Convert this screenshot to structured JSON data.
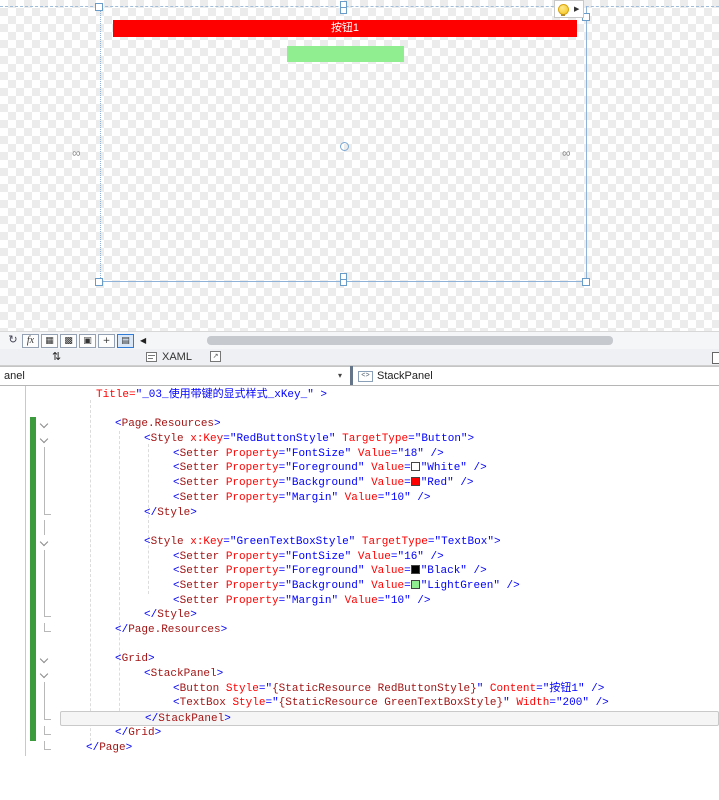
{
  "design": {
    "button_label": "按钮1",
    "button_color": "#ff0000",
    "textbox_color": "#90ee90",
    "bulb_arrow": "▶",
    "chain_glyph": "∞"
  },
  "toolbar": {
    "buttons": [
      {
        "name": "refresh-icon",
        "glyph": "↻",
        "boxed": false,
        "active": false
      },
      {
        "name": "effects-fx-icon",
        "glyph": "fx",
        "boxed": true,
        "active": false
      },
      {
        "name": "grid-rails-icon",
        "glyph": "▦",
        "boxed": true,
        "active": false
      },
      {
        "name": "grid-handles-icon",
        "glyph": "▩",
        "boxed": true,
        "active": false
      },
      {
        "name": "snap-grid-icon",
        "glyph": "▣",
        "boxed": true,
        "active": false
      },
      {
        "name": "snaplines-icon",
        "glyph": "+",
        "boxed": true,
        "active": false
      },
      {
        "name": "document-outline-icon",
        "glyph": "▤",
        "boxed": true,
        "active": true
      }
    ],
    "collapse_glyph": "◀"
  },
  "tabs": {
    "sort_glyph": "⇅",
    "xaml_label": "XAML"
  },
  "breadcrumb": {
    "left_value": "anel",
    "left_arrow": "▾",
    "right_icon_glyph": "<>",
    "right_value": "StackPanel"
  },
  "editor": {
    "change_bar_color": "#3c9b3c",
    "colors": {
      "delim": "#0000ff",
      "elem": "#a31515",
      "attr": "#ff0000",
      "value": "#0000ff",
      "plain": "#000000"
    },
    "lines": [
      {
        "ind": 36,
        "seg": [
          [
            "a",
            "Title="
          ],
          [
            "v",
            "\"_03_使用带键的显式样式_xKey_\""
          ],
          [
            "d",
            " >"
          ]
        ]
      },
      {
        "ind": 0,
        "seg": []
      },
      {
        "ind": 55,
        "fold": "o",
        "chg": true,
        "seg": [
          [
            "d",
            "<"
          ],
          [
            "e",
            "Page.Resources"
          ],
          [
            "d",
            ">"
          ]
        ]
      },
      {
        "ind": 84,
        "fold": "o",
        "chg": true,
        "seg": [
          [
            "d",
            "<"
          ],
          [
            "e",
            "Style"
          ],
          [
            "p",
            " "
          ],
          [
            "a",
            "x:Key"
          ],
          [
            "d",
            "="
          ],
          [
            "v",
            "\"RedButtonStyle\""
          ],
          [
            "p",
            " "
          ],
          [
            "a",
            "TargetType"
          ],
          [
            "d",
            "="
          ],
          [
            "v",
            "\"Button\""
          ],
          [
            "d",
            ">"
          ]
        ]
      },
      {
        "ind": 113,
        "fold": "i",
        "chg": true,
        "seg": [
          [
            "d",
            "<"
          ],
          [
            "e",
            "Setter"
          ],
          [
            "p",
            " "
          ],
          [
            "a",
            "Property"
          ],
          [
            "d",
            "="
          ],
          [
            "v",
            "\"FontSize\""
          ],
          [
            "p",
            " "
          ],
          [
            "a",
            "Value"
          ],
          [
            "d",
            "="
          ],
          [
            "v",
            "\"18\""
          ],
          [
            "d",
            " />"
          ]
        ]
      },
      {
        "ind": 113,
        "fold": "i",
        "chg": true,
        "seg": [
          [
            "d",
            "<"
          ],
          [
            "e",
            "Setter"
          ],
          [
            "p",
            " "
          ],
          [
            "a",
            "Property"
          ],
          [
            "d",
            "="
          ],
          [
            "v",
            "\"Foreground\""
          ],
          [
            "p",
            " "
          ],
          [
            "a",
            "Value"
          ],
          [
            "d",
            "="
          ],
          [
            "sw",
            "#ffffff"
          ],
          [
            "v",
            "\"White\""
          ],
          [
            "d",
            " />"
          ]
        ]
      },
      {
        "ind": 113,
        "fold": "i",
        "chg": true,
        "seg": [
          [
            "d",
            "<"
          ],
          [
            "e",
            "Setter"
          ],
          [
            "p",
            " "
          ],
          [
            "a",
            "Property"
          ],
          [
            "d",
            "="
          ],
          [
            "v",
            "\"Background\""
          ],
          [
            "p",
            " "
          ],
          [
            "a",
            "Value"
          ],
          [
            "d",
            "="
          ],
          [
            "sw",
            "#ff0000"
          ],
          [
            "v",
            "\"Red\""
          ],
          [
            "d",
            " />"
          ]
        ]
      },
      {
        "ind": 113,
        "fold": "i",
        "chg": true,
        "seg": [
          [
            "d",
            "<"
          ],
          [
            "e",
            "Setter"
          ],
          [
            "p",
            " "
          ],
          [
            "a",
            "Property"
          ],
          [
            "d",
            "="
          ],
          [
            "v",
            "\"Margin\""
          ],
          [
            "p",
            " "
          ],
          [
            "a",
            "Value"
          ],
          [
            "d",
            "="
          ],
          [
            "v",
            "\"10\""
          ],
          [
            "d",
            " />"
          ]
        ]
      },
      {
        "ind": 84,
        "fold": "c",
        "chg": true,
        "seg": [
          [
            "d",
            "</"
          ],
          [
            "e",
            "Style"
          ],
          [
            "d",
            ">"
          ]
        ]
      },
      {
        "ind": 0,
        "fold": "i",
        "chg": true,
        "seg": []
      },
      {
        "ind": 84,
        "fold": "o",
        "chg": true,
        "seg": [
          [
            "d",
            "<"
          ],
          [
            "e",
            "Style"
          ],
          [
            "p",
            " "
          ],
          [
            "a",
            "x:Key"
          ],
          [
            "d",
            "="
          ],
          [
            "v",
            "\"GreenTextBoxStyle\""
          ],
          [
            "p",
            " "
          ],
          [
            "a",
            "TargetType"
          ],
          [
            "d",
            "="
          ],
          [
            "v",
            "\"TextBox\""
          ],
          [
            "d",
            ">"
          ]
        ]
      },
      {
        "ind": 113,
        "fold": "i",
        "chg": true,
        "seg": [
          [
            "d",
            "<"
          ],
          [
            "e",
            "Setter"
          ],
          [
            "p",
            " "
          ],
          [
            "a",
            "Property"
          ],
          [
            "d",
            "="
          ],
          [
            "v",
            "\"FontSize\""
          ],
          [
            "p",
            " "
          ],
          [
            "a",
            "Value"
          ],
          [
            "d",
            "="
          ],
          [
            "v",
            "\"16\""
          ],
          [
            "d",
            " />"
          ]
        ]
      },
      {
        "ind": 113,
        "fold": "i",
        "chg": true,
        "seg": [
          [
            "d",
            "<"
          ],
          [
            "e",
            "Setter"
          ],
          [
            "p",
            " "
          ],
          [
            "a",
            "Property"
          ],
          [
            "d",
            "="
          ],
          [
            "v",
            "\"Foreground\""
          ],
          [
            "p",
            " "
          ],
          [
            "a",
            "Value"
          ],
          [
            "d",
            "="
          ],
          [
            "sw",
            "#000000"
          ],
          [
            "v",
            "\"Black\""
          ],
          [
            "d",
            " />"
          ]
        ]
      },
      {
        "ind": 113,
        "fold": "i",
        "chg": true,
        "seg": [
          [
            "d",
            "<"
          ],
          [
            "e",
            "Setter"
          ],
          [
            "p",
            " "
          ],
          [
            "a",
            "Property"
          ],
          [
            "d",
            "="
          ],
          [
            "v",
            "\"Background\""
          ],
          [
            "p",
            " "
          ],
          [
            "a",
            "Value"
          ],
          [
            "d",
            "="
          ],
          [
            "sw",
            "#90ee90"
          ],
          [
            "v",
            "\"LightGreen\""
          ],
          [
            "d",
            " />"
          ]
        ]
      },
      {
        "ind": 113,
        "fold": "i",
        "chg": true,
        "seg": [
          [
            "d",
            "<"
          ],
          [
            "e",
            "Setter"
          ],
          [
            "p",
            " "
          ],
          [
            "a",
            "Property"
          ],
          [
            "d",
            "="
          ],
          [
            "v",
            "\"Margin\""
          ],
          [
            "p",
            " "
          ],
          [
            "a",
            "Value"
          ],
          [
            "d",
            "="
          ],
          [
            "v",
            "\"10\""
          ],
          [
            "d",
            " />"
          ]
        ]
      },
      {
        "ind": 84,
        "fold": "c",
        "chg": true,
        "seg": [
          [
            "d",
            "</"
          ],
          [
            "e",
            "Style"
          ],
          [
            "d",
            ">"
          ]
        ]
      },
      {
        "ind": 55,
        "fold": "c",
        "chg": true,
        "seg": [
          [
            "d",
            "</"
          ],
          [
            "e",
            "Page.Resources"
          ],
          [
            "d",
            ">"
          ]
        ]
      },
      {
        "ind": 0,
        "chg": true,
        "seg": []
      },
      {
        "ind": 55,
        "fold": "o",
        "chg": true,
        "seg": [
          [
            "d",
            "<"
          ],
          [
            "e",
            "Grid"
          ],
          [
            "d",
            ">"
          ]
        ]
      },
      {
        "ind": 84,
        "fold": "o",
        "chg": true,
        "seg": [
          [
            "d",
            "<"
          ],
          [
            "e",
            "StackPanel"
          ],
          [
            "d",
            ">"
          ]
        ]
      },
      {
        "ind": 113,
        "fold": "i",
        "chg": true,
        "seg": [
          [
            "d",
            "<"
          ],
          [
            "e",
            "Button"
          ],
          [
            "p",
            " "
          ],
          [
            "a",
            "Style"
          ],
          [
            "d",
            "="
          ],
          [
            "v",
            "\""
          ],
          [
            "e",
            "{StaticResource RedButtonStyle}"
          ],
          [
            "v",
            "\""
          ],
          [
            "p",
            " "
          ],
          [
            "a",
            "Content"
          ],
          [
            "d",
            "="
          ],
          [
            "v",
            "\"按钮1\""
          ],
          [
            "d",
            " />"
          ]
        ]
      },
      {
        "ind": 113,
        "fold": "i",
        "chg": true,
        "seg": [
          [
            "d",
            "<"
          ],
          [
            "e",
            "TextBox"
          ],
          [
            "p",
            " "
          ],
          [
            "a",
            "Style"
          ],
          [
            "d",
            "="
          ],
          [
            "v",
            "\""
          ],
          [
            "e",
            "{StaticResource GreenTextBoxStyle}"
          ],
          [
            "v",
            "\""
          ],
          [
            "p",
            " "
          ],
          [
            "a",
            "Width"
          ],
          [
            "d",
            "="
          ],
          [
            "v",
            "\"200\""
          ],
          [
            "d",
            " />"
          ]
        ]
      },
      {
        "ind": 84,
        "fold": "c",
        "chg": true,
        "cur": true,
        "seg": [
          [
            "d",
            "</"
          ],
          [
            "e",
            "StackPanel"
          ],
          [
            "d",
            ">"
          ]
        ]
      },
      {
        "ind": 55,
        "fold": "c",
        "chg": true,
        "seg": [
          [
            "d",
            "</"
          ],
          [
            "e",
            "Grid"
          ],
          [
            "d",
            ">"
          ]
        ]
      },
      {
        "ind": 26,
        "fold": "c",
        "seg": [
          [
            "d",
            "</"
          ],
          [
            "e",
            "Page"
          ],
          [
            "d",
            ">"
          ]
        ]
      }
    ]
  }
}
